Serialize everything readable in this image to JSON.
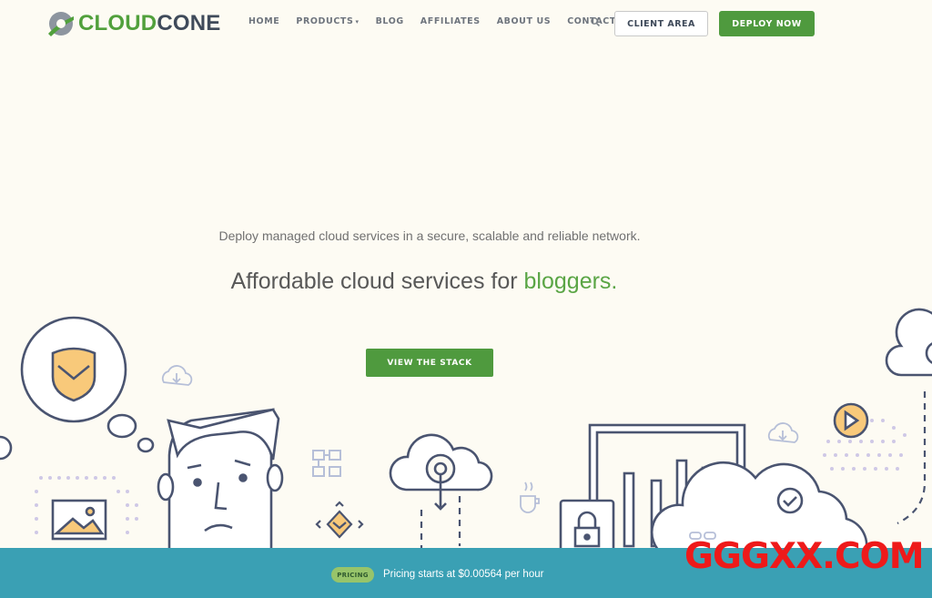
{
  "brand": {
    "name_part1": "CLOUD",
    "name_part2": "CONE"
  },
  "nav": {
    "items": [
      {
        "label": "HOME"
      },
      {
        "label": "PRODUCTS",
        "has_dropdown": true
      },
      {
        "label": "BLOG"
      },
      {
        "label": "AFFILIATES"
      },
      {
        "label": "ABOUT US"
      },
      {
        "label": "CONTACT"
      }
    ],
    "search_icon": "search-icon",
    "client_area_label": "CLIENT AREA",
    "deploy_label": "DEPLOY NOW"
  },
  "hero": {
    "subtitle": "Deploy managed cloud services in a secure, scalable and reliable network.",
    "title_prefix": "Affordable cloud services for ",
    "title_highlight": "bloggers.",
    "cta_label": "VIEW THE STACK"
  },
  "bottom_bar": {
    "badge": "PRICING",
    "text": "Pricing starts at $0.00564 per hour"
  },
  "watermark": "GGGXX.COM",
  "colors": {
    "background": "#fdfbf3",
    "accent_green": "#4f9a3e",
    "highlight_green": "#5aa545",
    "bar_teal": "#3aa0b4",
    "watermark_red": "#ee1a1a"
  }
}
